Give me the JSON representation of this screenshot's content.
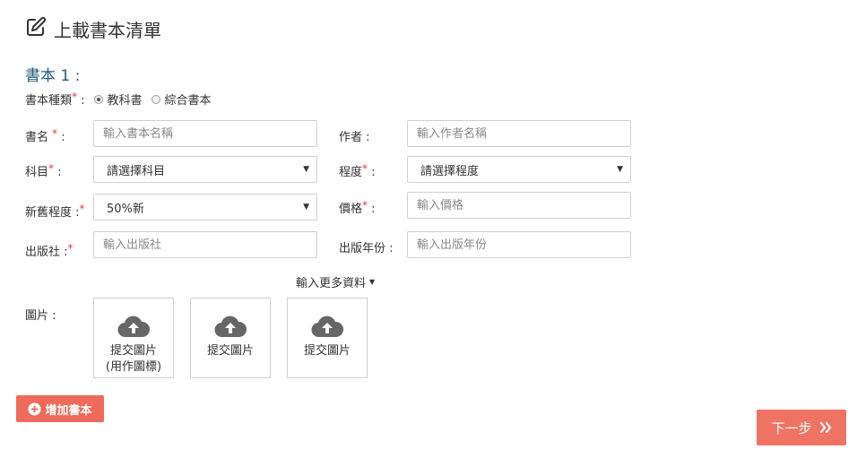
{
  "page": {
    "title": "上載書本清單",
    "book_heading": "書本 1 :"
  },
  "book_type": {
    "label": "書本種類",
    "required_mark": "*",
    "colon": " :",
    "options": [
      {
        "label": "教科書",
        "checked": true
      },
      {
        "label": "綜合書本",
        "checked": false
      }
    ]
  },
  "fields": {
    "name": {
      "label": "書名",
      "required_mark": "*",
      "colon": " :",
      "placeholder": "輸入書本名稱"
    },
    "author": {
      "label": "作者 :",
      "placeholder": "輸入作者名稱"
    },
    "subject": {
      "label": "科目",
      "required_mark": "*",
      "colon": " :",
      "value": "請選擇科目"
    },
    "level": {
      "label": "程度",
      "required_mark": "*",
      "colon": " :",
      "value": "請選擇程度"
    },
    "condition": {
      "label": "新舊程度 :",
      "required_mark": "*",
      "value": "50%新"
    },
    "price": {
      "label": "價格",
      "required_mark": "*",
      "colon": " :",
      "placeholder": "輸入價格"
    },
    "publisher": {
      "label": "出版社 :",
      "required_mark": "*",
      "placeholder": "輸入出版社"
    },
    "year": {
      "label": "出版年份 :",
      "placeholder": "輸入出版年份"
    }
  },
  "more_info": {
    "label": "輸入更多資料"
  },
  "images": {
    "label": "圖片 :",
    "slots": [
      {
        "line1": "提交圖片",
        "line2": "(用作圖標)"
      },
      {
        "line1": "提交圖片",
        "line2": ""
      },
      {
        "line1": "提交圖片",
        "line2": ""
      }
    ]
  },
  "buttons": {
    "add_book": "增加書本",
    "next_step": "下一步"
  },
  "colors": {
    "accent": "#ee6a5a",
    "heading": "#1f5d7a",
    "required": "#e2393b"
  }
}
